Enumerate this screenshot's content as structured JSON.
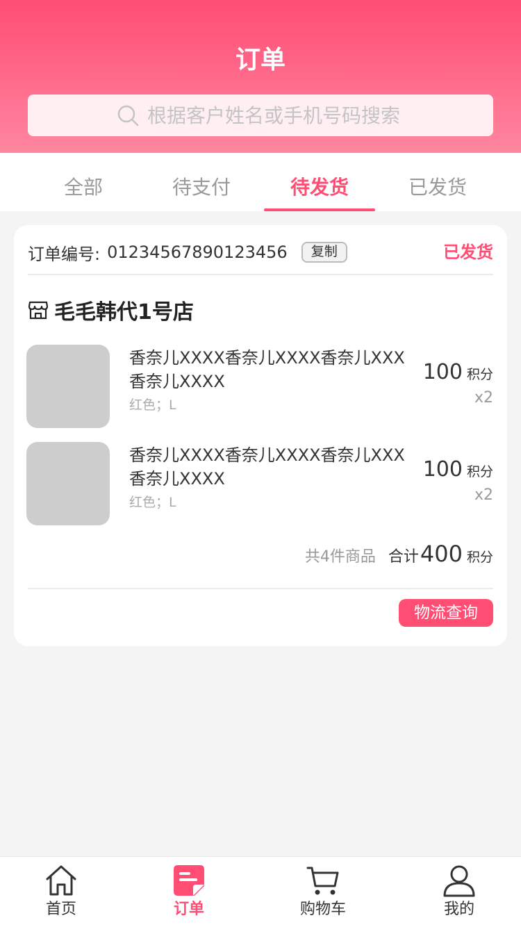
{
  "header": {
    "title": "订单",
    "search_placeholder": "根据客户姓名或手机号码搜索",
    "search_icon": "search-icon"
  },
  "tabs": [
    {
      "label": "全部",
      "active": false
    },
    {
      "label": "待支付",
      "active": false
    },
    {
      "label": "待发货",
      "active": true
    },
    {
      "label": "已发货",
      "active": false
    }
  ],
  "order": {
    "number_label": "订单编号:",
    "number": "01234567890123456",
    "copy_label": "复制",
    "status": "已发货",
    "store_icon": "store-icon",
    "store_name": "毛毛韩代1号店",
    "items": [
      {
        "title": "香奈儿XXXX香奈儿XXXX香奈儿XXX香奈儿XXXX",
        "spec": "红色；L",
        "price": "100",
        "unit": "积分",
        "qty": "x2"
      },
      {
        "title": "香奈儿XXXX香奈儿XXXX香奈儿XXX香奈儿XXXX",
        "spec": "红色；L",
        "price": "100",
        "unit": "积分",
        "qty": "x2"
      }
    ],
    "summary": {
      "count_text": "共4件商品",
      "total_label": "合计",
      "total": "400",
      "unit": "积分"
    },
    "logistics_label": "物流查询"
  },
  "tabbar": [
    {
      "label": "首页",
      "icon": "home-icon",
      "active": false
    },
    {
      "label": "订单",
      "icon": "order-icon",
      "active": true
    },
    {
      "label": "购物车",
      "icon": "cart-icon",
      "active": false
    },
    {
      "label": "我的",
      "icon": "user-icon",
      "active": false
    }
  ],
  "colors": {
    "accent": "#ff4d74",
    "header_gradient_top": "#ff4d74",
    "header_gradient_bottom": "#ff86a0"
  }
}
